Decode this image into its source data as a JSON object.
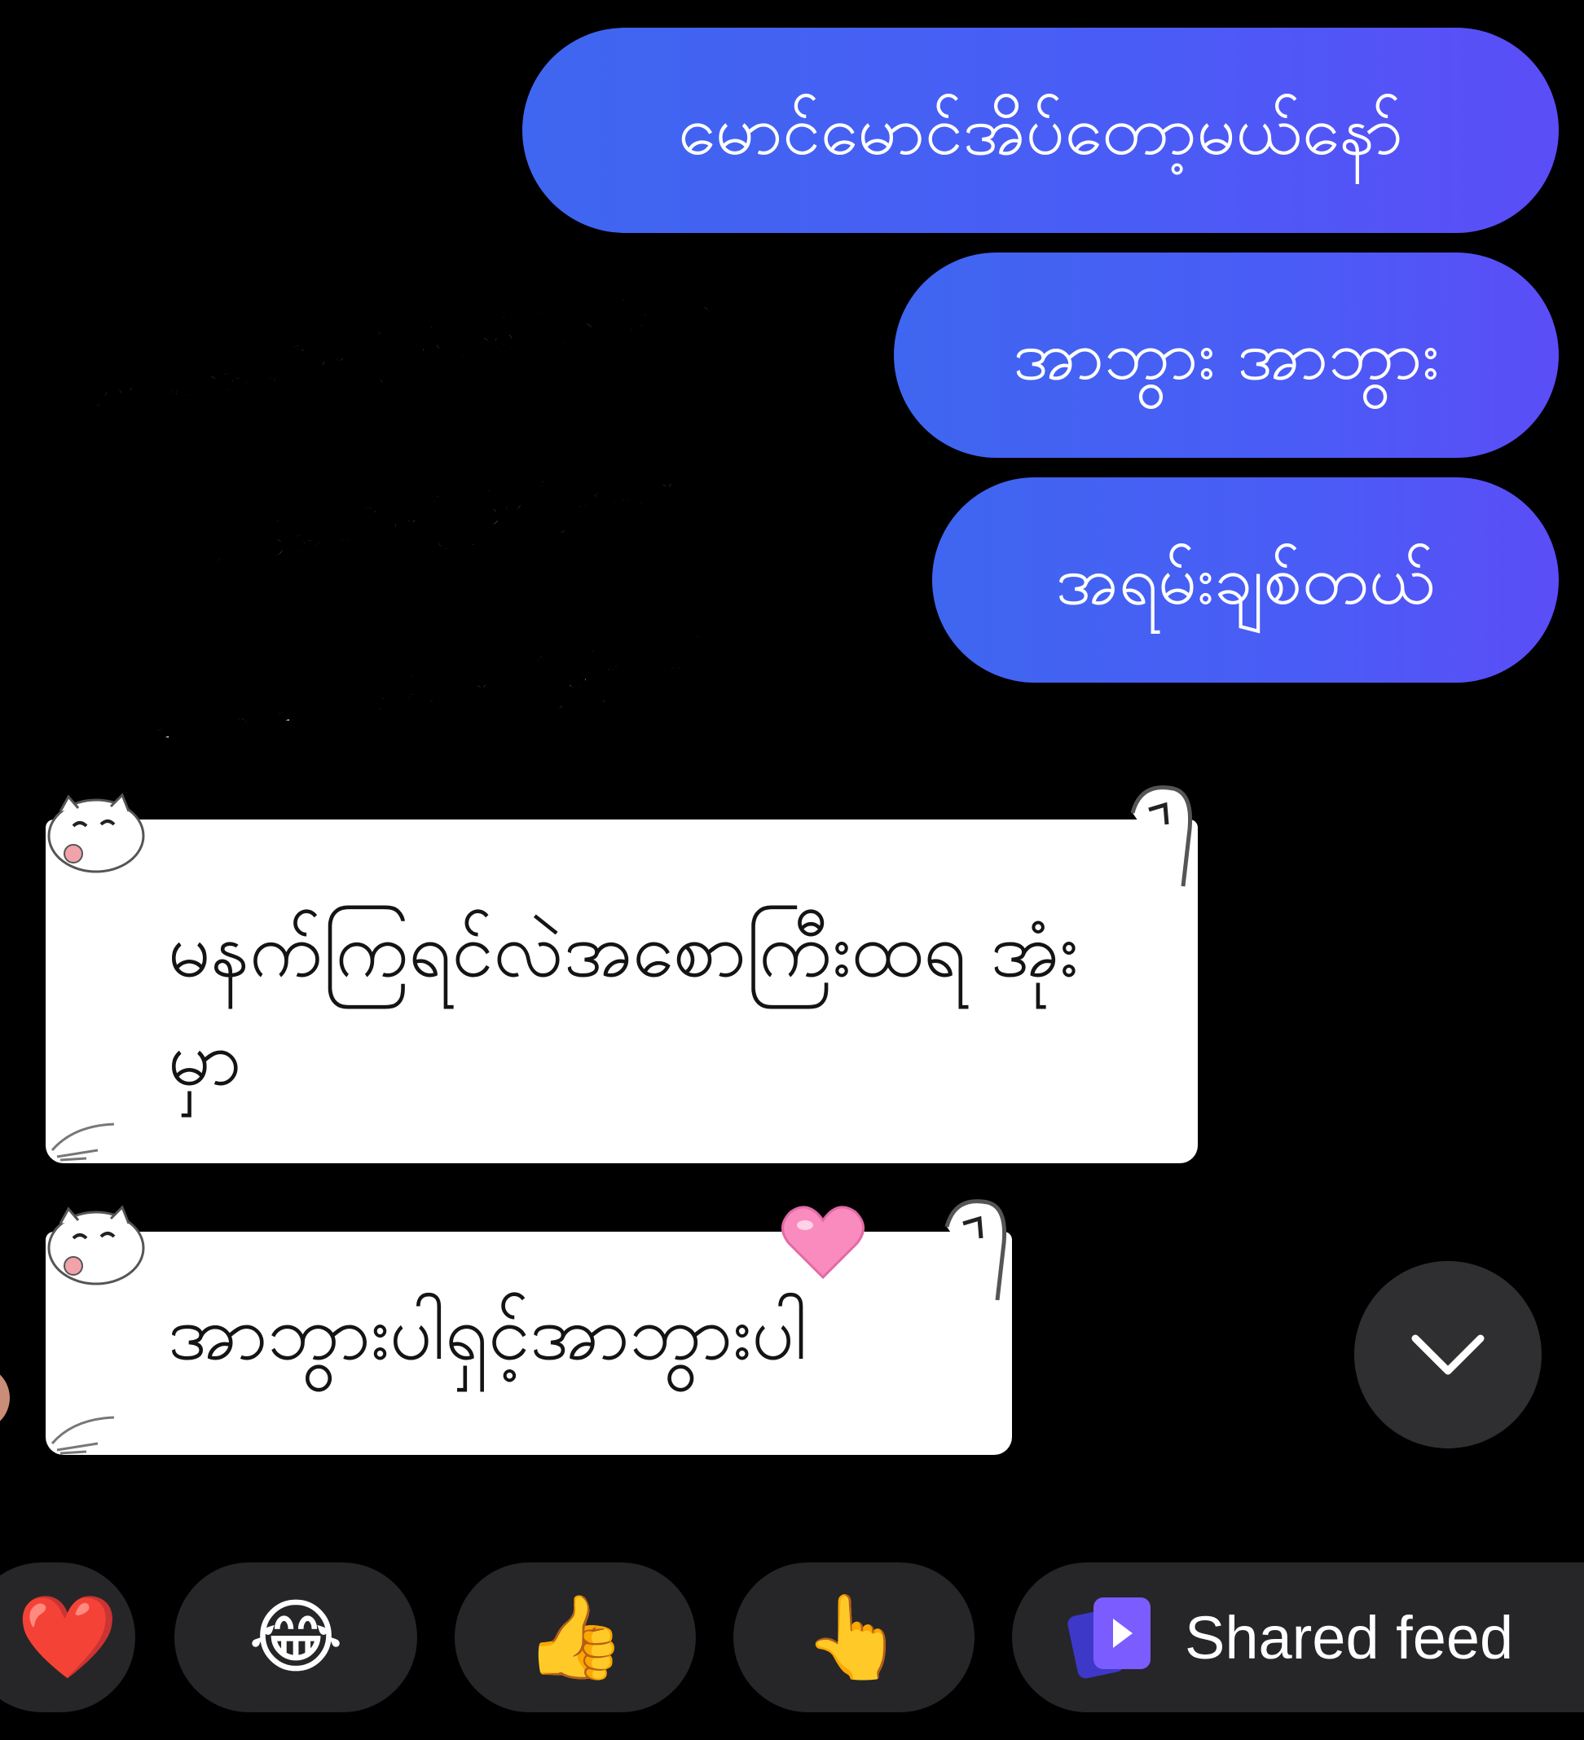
{
  "sent_messages": [
    "မောင်မောင်အိပ်တော့မယ်နော်",
    "အာဘွား အာဘွား",
    "အရမ်းချစ်တယ်"
  ],
  "overlay_lines": [
    "သူများတွေအပေါ်မှာ ကြမ်းတမ်းပါတယ်ဆိုတဲ့",
    "သူကငါ့အပေါ်မှာကြင်နာပြနေတော့",
    "ဒီလူဘဝဒီလူ့ကိုချစ်ရတာပီးပြည့်စုံပီးပေါ့"
  ],
  "received_messages": [
    "မနက်ကြရင်လဲအစောကြီးထရ အုံးမှာ",
    "အာဘွားပါရှင့်အာဘွားပါ"
  ],
  "reactions": [
    {
      "icon": "red-heart-icon",
      "glyph": "❤️"
    },
    {
      "icon": "tears-of-joy-icon",
      "glyph": "😂"
    },
    {
      "icon": "thumbs-up-icon",
      "glyph": "👍"
    },
    {
      "icon": "pointing-hand-icon",
      "glyph": "👆"
    }
  ],
  "shared_feed": {
    "label": "Shared feed",
    "icon": "shared-feed-icon"
  },
  "colors": {
    "background": "#000000",
    "sent_bubble_start": "#3f66f0",
    "sent_bubble_end": "#5b4df7",
    "reaction_pill": "#262628",
    "scroll_button": "#2f2f31",
    "heart_pink": "#f98bbf"
  }
}
